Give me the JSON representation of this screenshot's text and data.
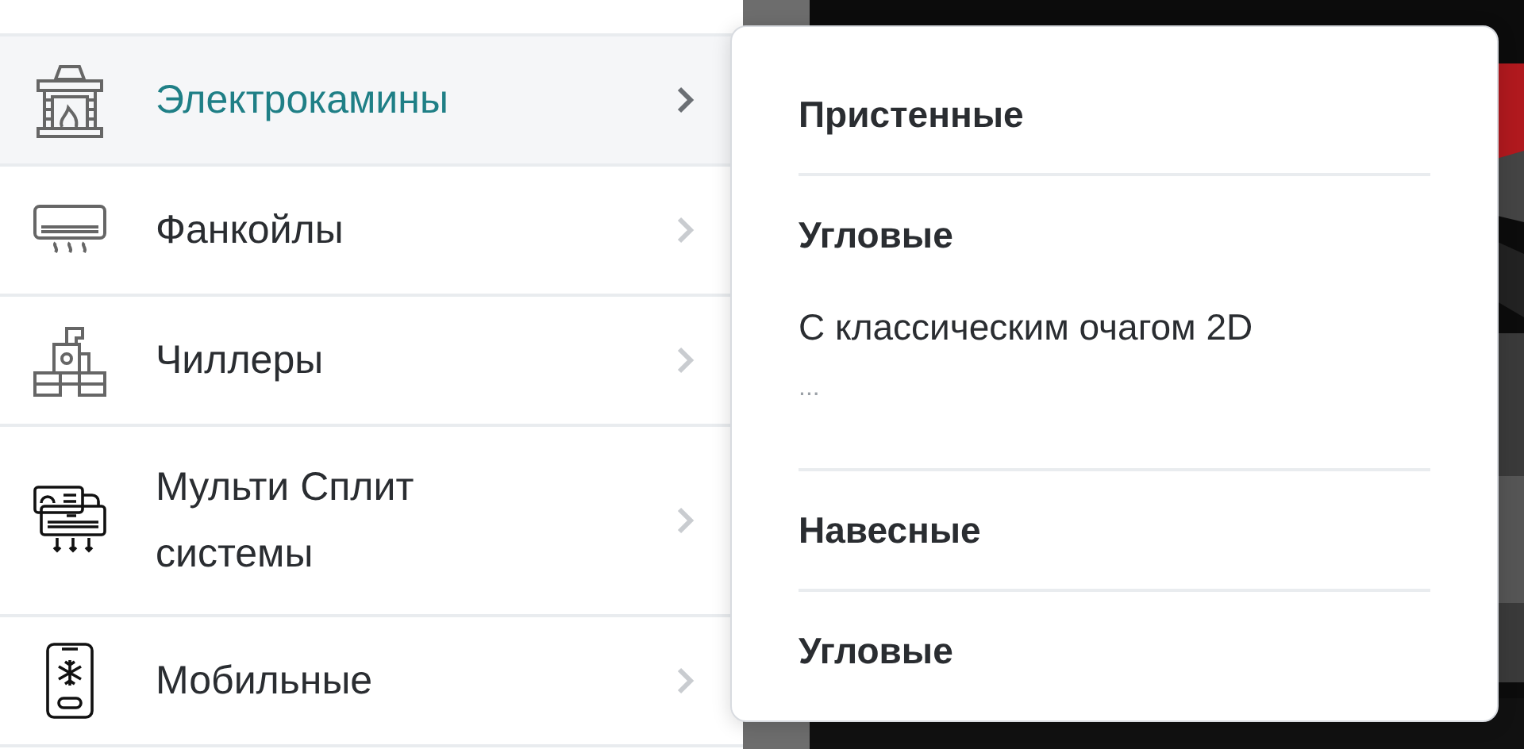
{
  "menu": {
    "items": [
      {
        "kind": "fireplace",
        "label": "Электрокамины",
        "selected": true
      },
      {
        "kind": "fancoil",
        "label": "Фанкойлы",
        "selected": false
      },
      {
        "kind": "chiller",
        "label": "Чиллеры",
        "selected": false
      },
      {
        "kind": "split",
        "label": "Мульти Сплит системы",
        "selected": false
      },
      {
        "kind": "mobile",
        "label": "Мобильные",
        "selected": false
      }
    ]
  },
  "submenu": {
    "groups": [
      {
        "items": [
          {
            "kind": "heading",
            "label": "Пристенные"
          }
        ]
      },
      {
        "items": [
          {
            "kind": "heading",
            "label": "Угловые"
          },
          {
            "kind": "link",
            "label": "С классическим очагом 2D"
          },
          {
            "kind": "more",
            "label": "..."
          }
        ]
      },
      {
        "items": [
          {
            "kind": "heading",
            "label": "Навесные"
          }
        ]
      },
      {
        "items": [
          {
            "kind": "heading",
            "label": "Угловые"
          }
        ]
      }
    ]
  }
}
